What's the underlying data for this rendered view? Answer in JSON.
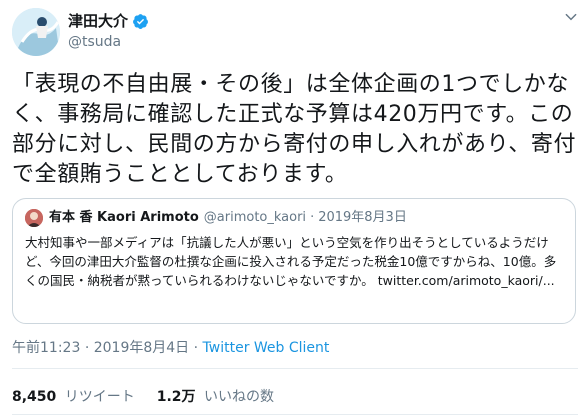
{
  "author": {
    "display_name": "津田大介",
    "handle": "@tsuda",
    "verified": true
  },
  "tweet_text": "「表現の不自由展・その後」は全体企画の1つでしかなく、事務局に確認した正式な予算は420万円です。この部分に対し、民間の方から寄付の申し入れがあり、寄付で全額賄うこととしております。",
  "quoted_tweet": {
    "display_name": "有本 香 Kaori Arimoto",
    "handle": "@arimoto_kaori",
    "separator": "·",
    "date": "2019年8月3日",
    "text": "大村知事や一部メディアは「抗議した人が悪い」という空気を作り出そうとしているようだけど、今回の津田大介監督の杜撰な企画に投入される予定だった税金10億ですからね、10億。多くの国民・納税者が黙っていられるわけないじゃないですか。 twitter.com/arimoto_kaori/..."
  },
  "meta": {
    "time": "午前11:23",
    "date": "2019年8月4日",
    "separator": "·",
    "client": "Twitter Web Client"
  },
  "stats": {
    "retweets_count": "8,450",
    "retweets_label": "リツイート",
    "likes_count": "1.2万",
    "likes_label": "いいねの数"
  },
  "icons": [
    "avatar-image",
    "verified-badge-icon",
    "chevron-down-icon"
  ],
  "colors": {
    "link": "#1b95e0",
    "muted": "#657786",
    "border": "#ccd6dd",
    "verified": "#1da1f2"
  }
}
